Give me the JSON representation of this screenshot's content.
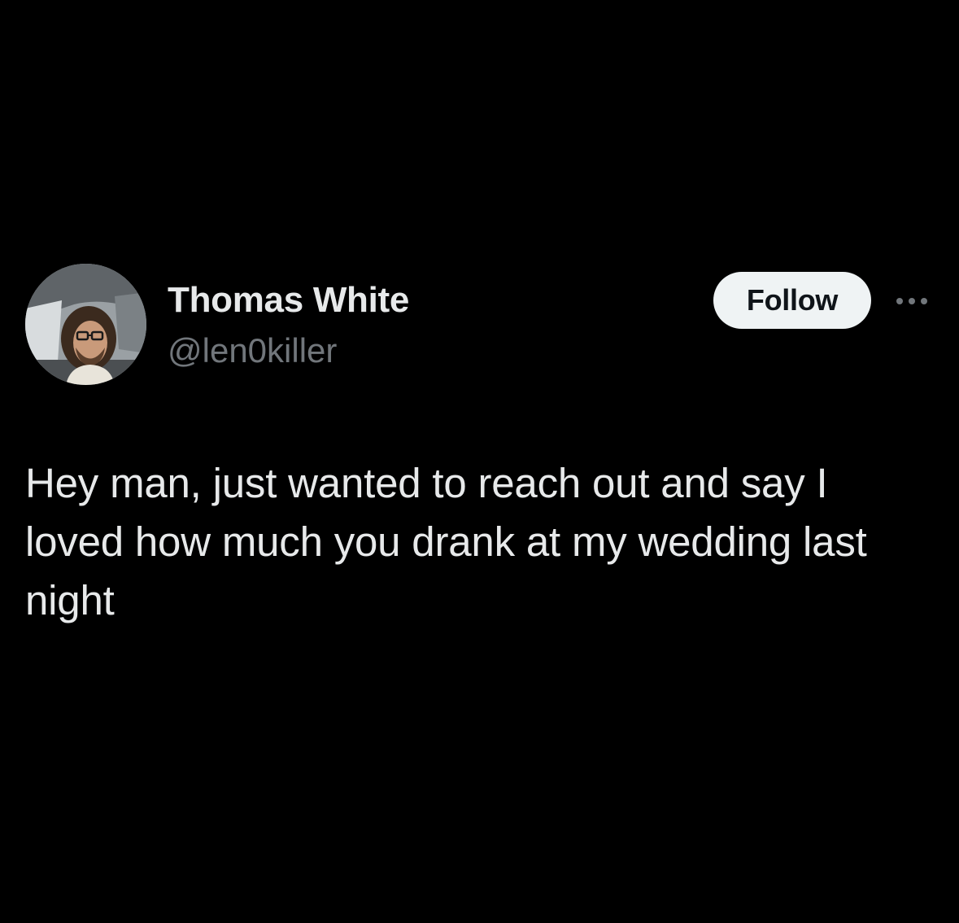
{
  "tweet": {
    "author": {
      "display_name": "Thomas White",
      "handle": "@len0killer",
      "avatar_icon": "profile-photo"
    },
    "follow_label": "Follow",
    "more_icon": "more-horizontal-icon",
    "text": "Hey man, just wanted to reach out and say I loved how much you drank at my wedding last night"
  },
  "colors": {
    "background": "#000000",
    "primary_text": "#e7e9ea",
    "secondary_text": "#71767b",
    "follow_button_bg": "#eff3f4",
    "follow_button_text": "#0f1419"
  }
}
